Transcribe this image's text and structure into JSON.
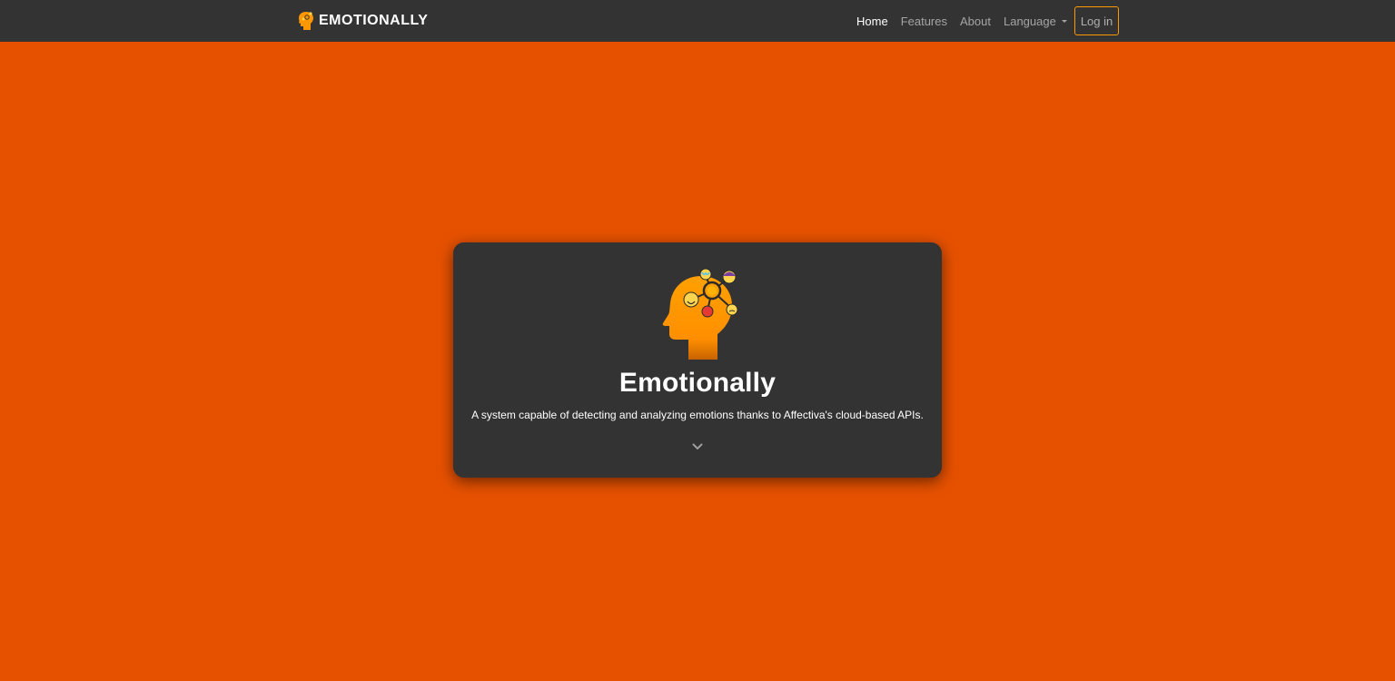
{
  "navbar": {
    "brand": "EMOTIONALLY",
    "brand_icon": "head-logo-icon",
    "links": [
      {
        "label": "Home",
        "active": true
      },
      {
        "label": "Features",
        "active": false
      },
      {
        "label": "About",
        "active": false
      }
    ],
    "language_label": "Language",
    "login_label": "Log in"
  },
  "hero": {
    "title": "Emotionally",
    "subtitle": "A system capable of detecting and analyzing emotions thanks to Affectiva's cloud-based APIs.",
    "image_icon": "head-emotions-icon",
    "scroll_icon": "chevron-down-icon"
  },
  "colors": {
    "background": "#e65100",
    "navbar": "#333333",
    "card": "#333333",
    "accent": "#ff9800"
  }
}
